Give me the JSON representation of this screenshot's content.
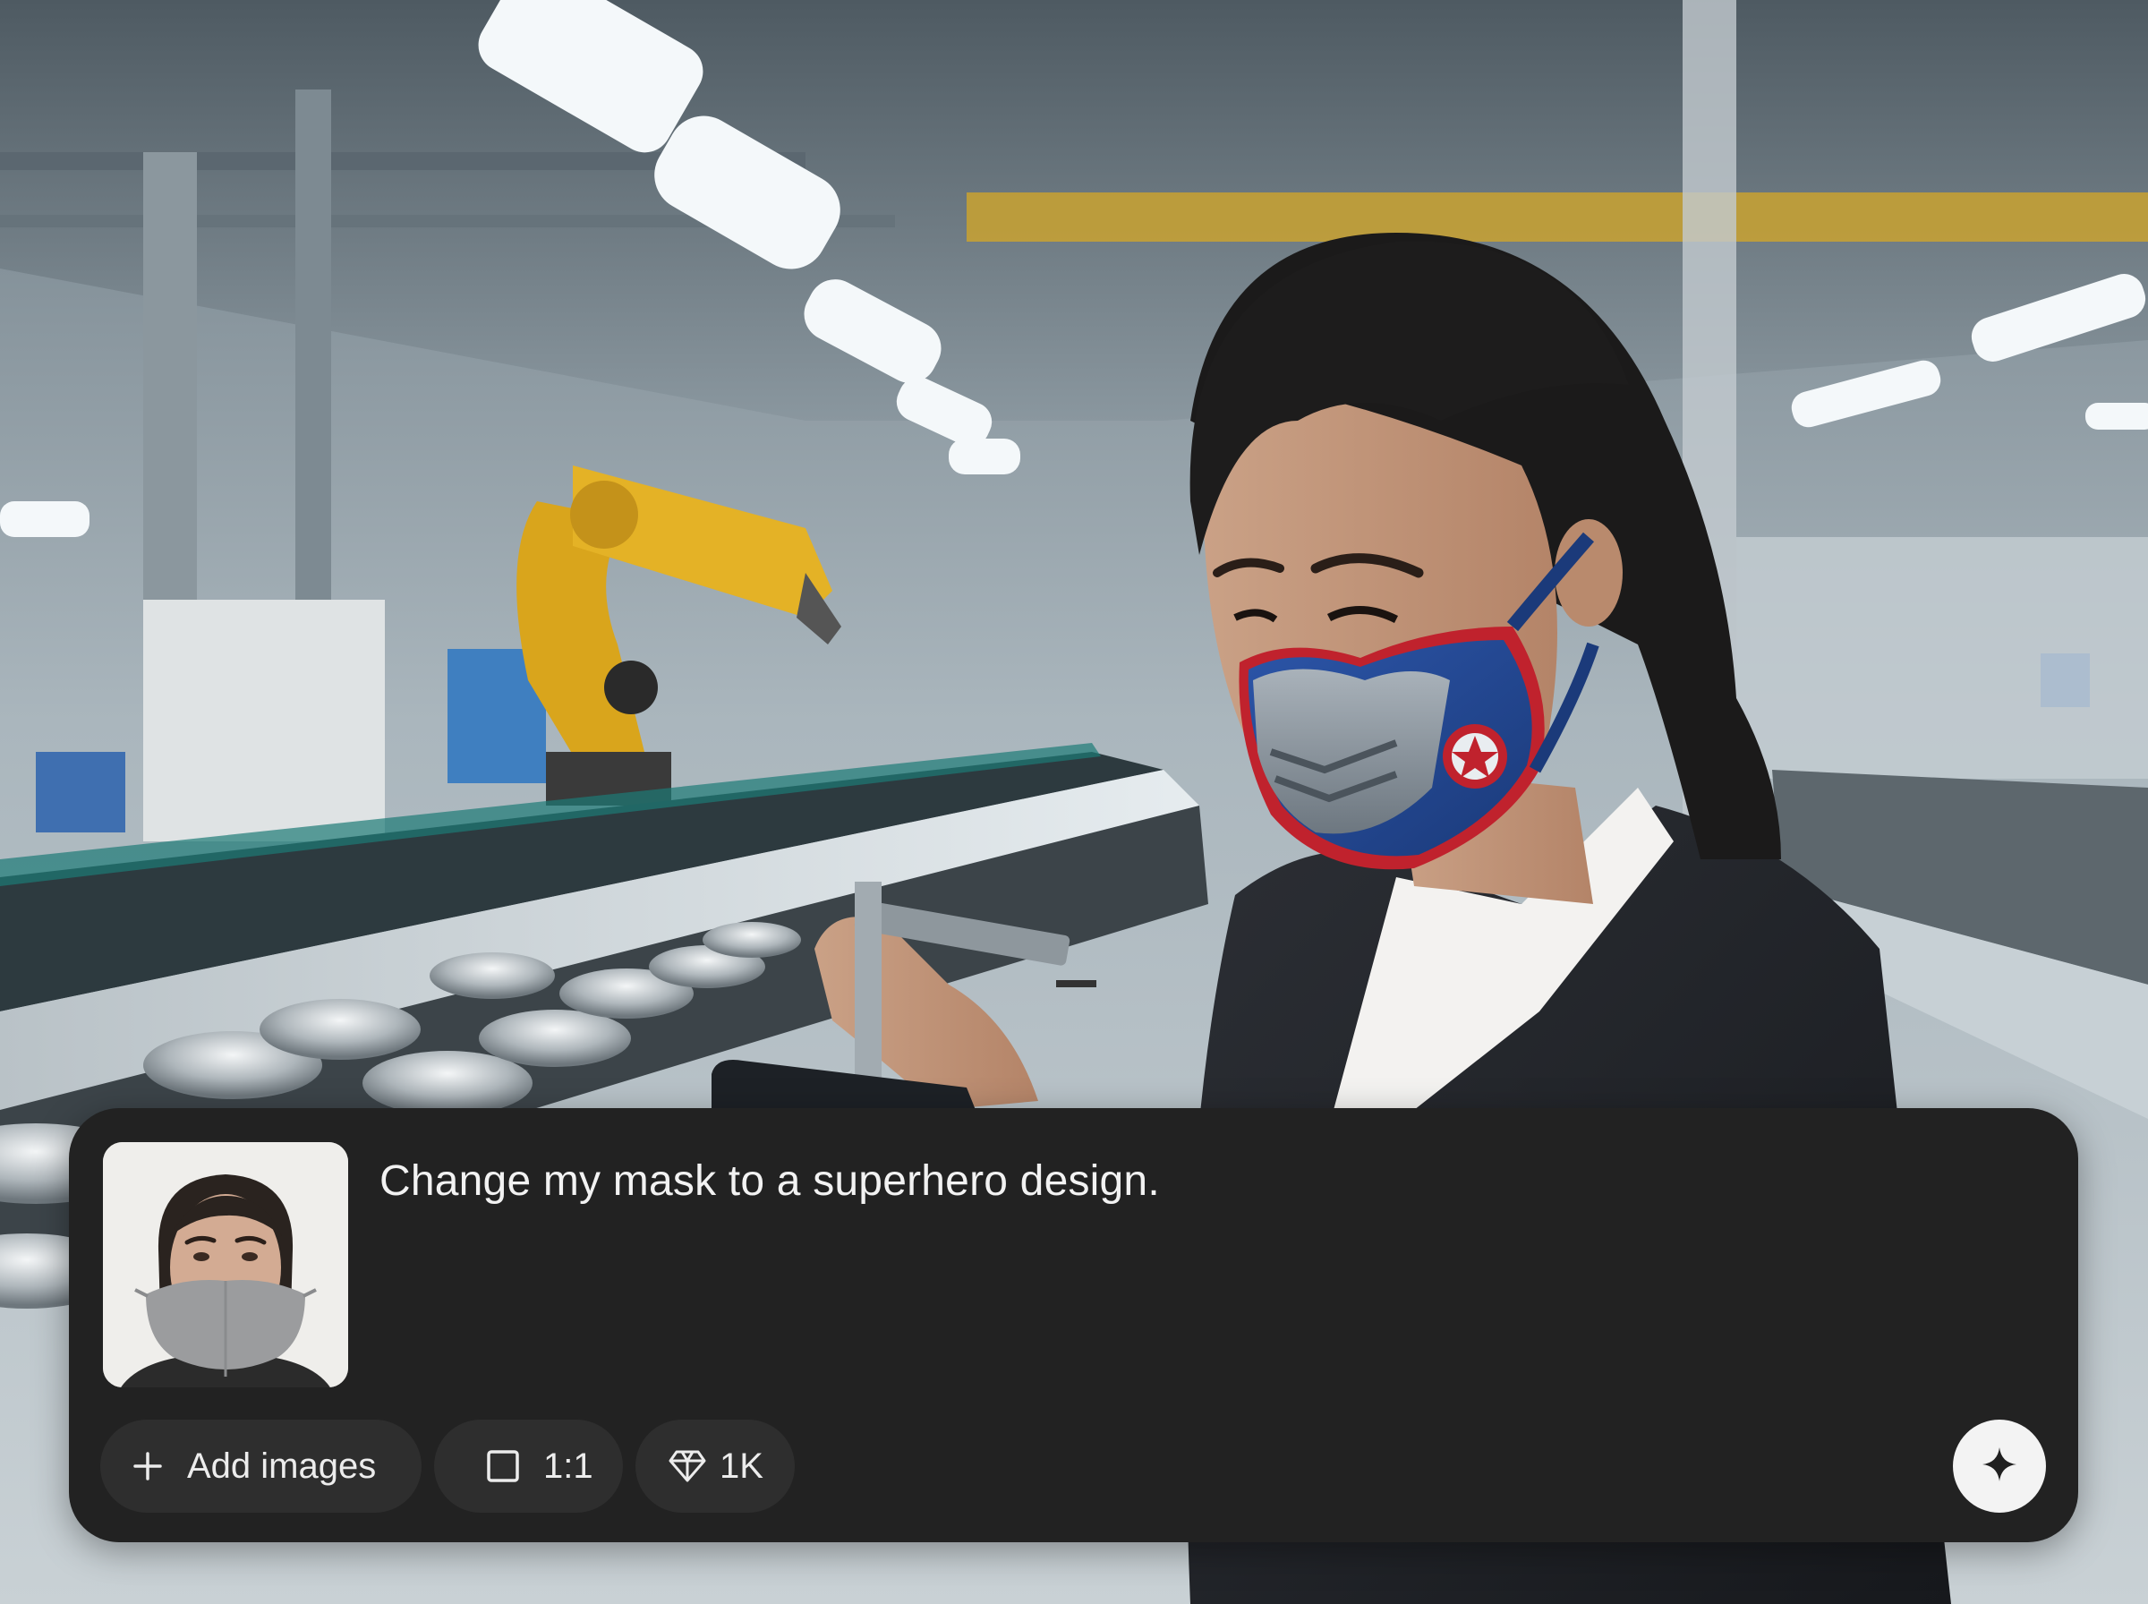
{
  "prompt": {
    "text": "Change my mask to a superhero design.",
    "thumbnail_icon": "reference-photo-person-cloth-mask"
  },
  "toolbar": {
    "add_images_label": "Add images",
    "add_icon": "plus-icon",
    "aspect_ratio_label": "1:1",
    "aspect_icon": "square-icon",
    "resolution_label": "1K",
    "resolution_icon": "diamond-icon",
    "send_icon": "sparkle-icon"
  },
  "colors": {
    "panel_bg": "#222222",
    "chip_bg": "#2e2e2e",
    "send_button_bg": "#f3f3f3",
    "text": "#f2f2f2"
  }
}
